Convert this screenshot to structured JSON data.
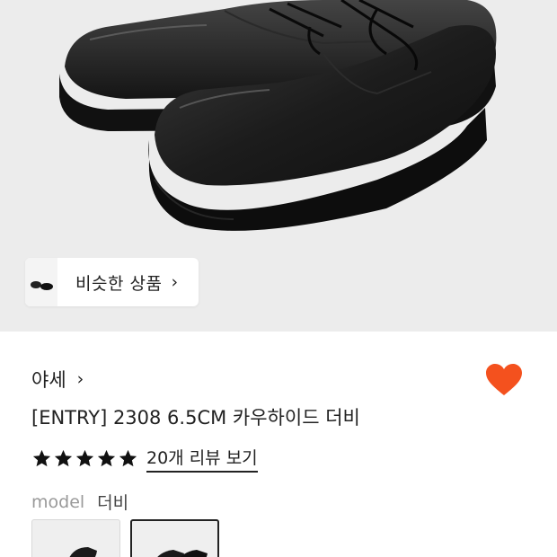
{
  "hero": {
    "image_icon": "shoe-product-photo",
    "similar_products": {
      "label": "비슷한 상품",
      "chevron": "›"
    }
  },
  "product": {
    "brand": "야세",
    "brand_chevron": "›",
    "title": "[ENTRY] 2308 6.5CM 카우하이드 더비",
    "liked": true,
    "accent_color": "#f4511e",
    "rating": {
      "stars": 5,
      "review_link": "20개 리뷰 보기"
    },
    "option": {
      "key": "model",
      "value": "더비"
    },
    "variants": [
      {
        "selected": false
      },
      {
        "selected": true
      }
    ]
  }
}
